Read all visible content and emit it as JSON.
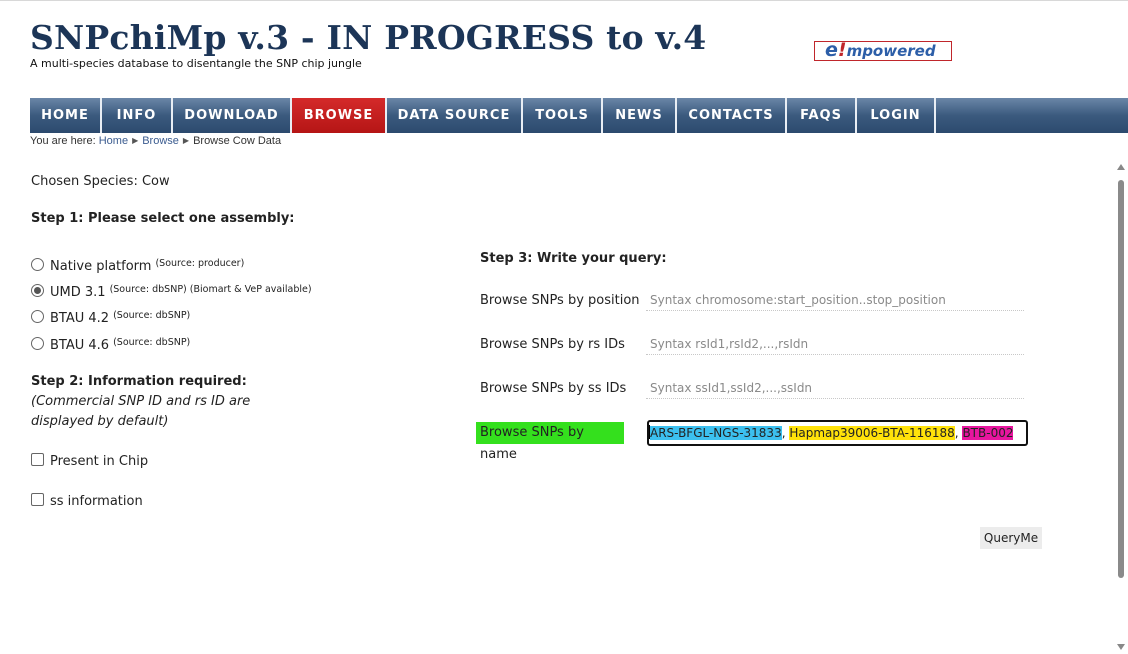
{
  "header": {
    "title": "SNPchiMp v.3 - IN PROGRESS to v.4",
    "subtitle": "A multi-species database to disentangle the SNP chip jungle",
    "logo_mark": "e",
    "logo_excl": "!",
    "logo_text": "mpowered"
  },
  "nav": {
    "items": [
      "HOME",
      "INFO",
      "DOWNLOAD",
      "BROWSE",
      "DATA SOURCE",
      "TOOLS",
      "NEWS",
      "CONTACTS",
      "FAQS",
      "LOGIN"
    ],
    "active": "BROWSE"
  },
  "breadcrumb": {
    "prefix": "You are here:",
    "items": [
      "Home",
      "Browse",
      "Browse Cow Data"
    ]
  },
  "form": {
    "chosen_species": "Chosen Species: Cow",
    "step1_title": "Step 1: Please select one assembly:",
    "assemblies": [
      {
        "label": "Native platform",
        "source": "(Source: producer)",
        "checked": false
      },
      {
        "label": "UMD 3.1",
        "source": "(Source: dbSNP) (Biomart & VeP available)",
        "checked": true
      },
      {
        "label": "BTAU 4.2",
        "source": "(Source: dbSNP)",
        "checked": false
      },
      {
        "label": "BTAU 4.6",
        "source": "(Source: dbSNP)",
        "checked": false
      }
    ],
    "step2_title": "Step 2: Information required:",
    "step2_note_line1": "(Commercial SNP ID and rs ID are",
    "step2_note_line2": "displayed by default)",
    "present_in_chip": "Present in Chip",
    "ss_information": "ss information",
    "step3_title": "Step 3: Write your query:",
    "queries": {
      "position_label": "Browse SNPs by position",
      "position_placeholder": "Syntax chromosome:start_position..stop_position",
      "rs_label": "Browse SNPs by rs IDs",
      "rs_placeholder": "Syntax rsId1,rsId2,...,rsIdn",
      "ss_label": "Browse SNPs by ss IDs",
      "ss_placeholder": "Syntax ssId1,ssId2,...,ssIdn",
      "name_label": "Browse SNPs by name",
      "name_tokens": [
        "ARS-BFGL-NGS-31833",
        "Hapmap39006-BTA-116188",
        "BTB-002"
      ],
      "name_sep": ", "
    },
    "submit_label": "QueryMe"
  },
  "colors": {
    "nav_active": "#c41e1e",
    "title": "#1c3557",
    "green_label": "#34e01d",
    "token_blue": "#3cc0ef",
    "token_yellow": "#ffe20a",
    "token_pink": "#e8159f"
  }
}
